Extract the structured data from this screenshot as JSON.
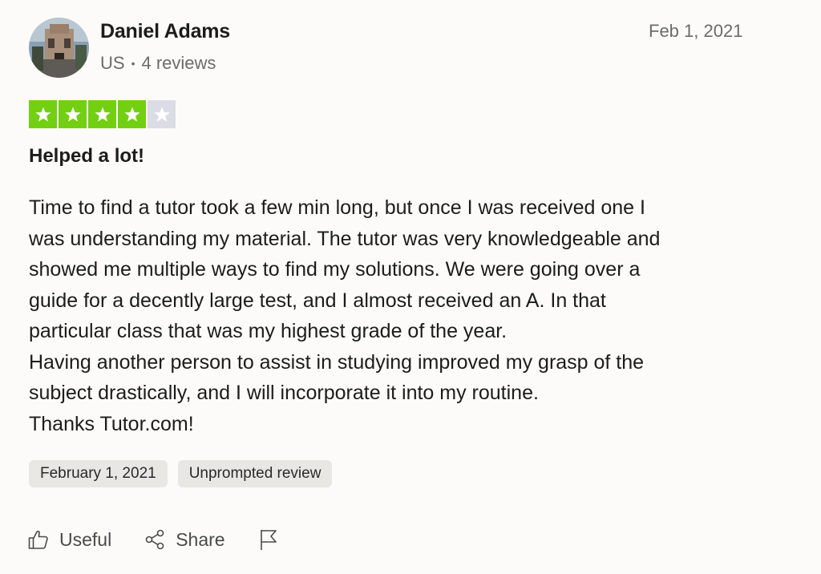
{
  "reviewer": {
    "name": "Daniel Adams",
    "country": "US",
    "reviews_count": "4 reviews"
  },
  "review": {
    "date_short": "Feb 1, 2021",
    "rating": 4,
    "rating_max": 5,
    "title": "Helped a lot!",
    "body_lines": [
      "Time to find a tutor took a few min long, but once I was received one I",
      "was understanding my material. The tutor was very knowledgeable and",
      "showed me multiple ways to find my solutions. We were going over a",
      "guide for a decently large test, and I almost received an A. In that",
      "particular class that was my highest grade of the year.",
      "Having another person to assist in studying improved my grasp of the",
      "subject drastically, and I will incorporate it into my routine.",
      "Thanks Tutor.com!"
    ],
    "tags": [
      "February 1, 2021",
      "Unprompted review"
    ]
  },
  "actions": {
    "useful_label": "Useful",
    "share_label": "Share"
  },
  "icons": {
    "useful": "thumbs-up-icon",
    "share": "share-icon",
    "report": "flag-icon",
    "star": "star-icon"
  },
  "colors": {
    "star_filled": "#73cf11",
    "star_empty": "#dcdce6",
    "tag_bg": "#e8e7e4",
    "muted_text": "#6b6b6b"
  }
}
